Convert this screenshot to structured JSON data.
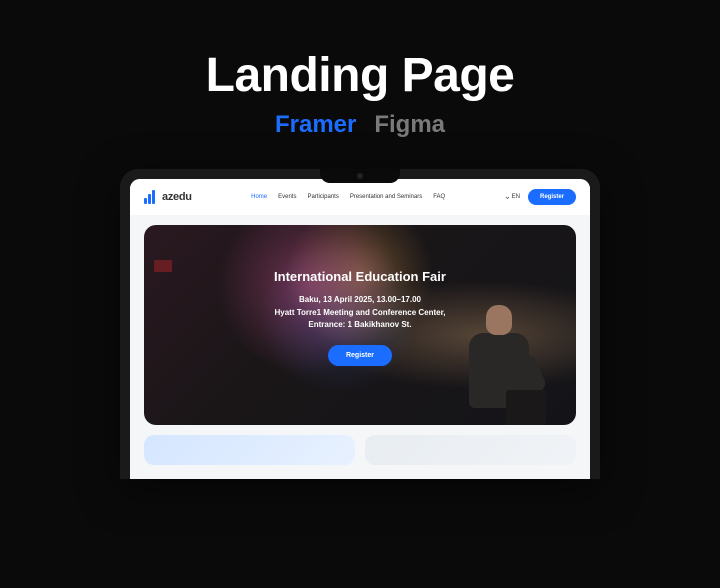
{
  "title": "Landing Page",
  "subtitle": {
    "framer": "Framer",
    "figma": "Figma"
  },
  "site": {
    "logo": "azedu",
    "nav": [
      {
        "label": "Home",
        "active": true
      },
      {
        "label": "Events",
        "active": false
      },
      {
        "label": "Participants",
        "active": false
      },
      {
        "label": "Presentation and Seminars",
        "active": false
      },
      {
        "label": "FAQ",
        "active": false
      }
    ],
    "lang": "EN",
    "register": "Register",
    "hero": {
      "title": "International Education Fair",
      "line1": "Baku, 13 April 2025, 13.00–17.00",
      "line2": "Hyatt Torre1 Meeting and Conference Center,",
      "line3": "Entrance: 1 Bakikhanov St.",
      "cta": "Register"
    }
  }
}
